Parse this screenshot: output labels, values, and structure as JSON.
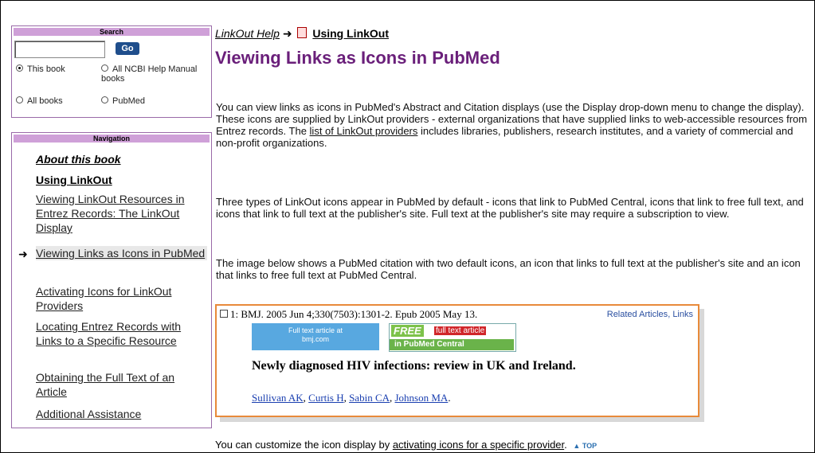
{
  "sidebar": {
    "search": {
      "title": "Search",
      "input_value": "",
      "go_label": "Go",
      "options": [
        {
          "label": "This book",
          "selected": true
        },
        {
          "label": "All NCBI Help Manual books",
          "selected": false
        },
        {
          "label": "All books",
          "selected": false
        },
        {
          "label": "PubMed",
          "selected": false
        }
      ]
    },
    "nav": {
      "title": "Navigation",
      "items": [
        {
          "label": "About this book"
        },
        {
          "label": "Using LinkOut"
        },
        {
          "label": "Viewing LinkOut Resources in Entrez Records: The LinkOut Display"
        },
        {
          "label": "Viewing Links as Icons in PubMed"
        },
        {
          "label": "Activating Icons for LinkOut Providers"
        },
        {
          "label": "Locating Entrez Records with Links to a Specific Resource"
        },
        {
          "label": "Obtaining the Full Text of an Article"
        },
        {
          "label": "Additional Assistance"
        }
      ]
    }
  },
  "breadcrumb": {
    "parent": "LinkOut Help",
    "arrow": "➜",
    "current": "Using LinkOut"
  },
  "main": {
    "title": "Viewing Links as Icons in PubMed",
    "p1_a": "You can view links as icons in PubMed's Abstract and Citation displays (use the Display drop-down menu to change the display). These icons are supplied by LinkOut providers - external organizations that have supplied links to web-accessible resources from Entrez records. The ",
    "p1_link": "list of LinkOut providers",
    "p1_b": " includes libraries, publishers, research institutes, and a variety of commercial and non-profit organizations.",
    "p2": "Three types of LinkOut icons appear in PubMed by default - icons that link to PubMed Central, icons that link to free full text, and icons that link to full text at the publisher's site. Full text at the publisher's site may require a subscription to view.",
    "p3": "The image below shows a PubMed citation with two default icons, an icon that links to full text at the publisher's site and an icon that links to free full text at PubMed Central.",
    "bottom_a": "You can customize the icon display by ",
    "bottom_link": "activating icons for a specific provider",
    "bottom_b": ".",
    "top_label": "TOP"
  },
  "citation": {
    "line": "1: BMJ. 2005 Jun 4;330(7503):1301-2. Epub 2005 May 13.",
    "related": "Related Articles",
    "links": "Links",
    "bmj_line1": "Full text article at",
    "bmj_line2": "bmj.com",
    "free_word": "FREE",
    "free_fulltext": "full text article",
    "free_pmc": "in PubMed Central",
    "title": "Newly diagnosed HIV infections: review in UK and Ireland.",
    "authors": [
      "Sullivan AK",
      "Curtis H",
      "Sabin CA",
      "Johnson MA"
    ]
  }
}
